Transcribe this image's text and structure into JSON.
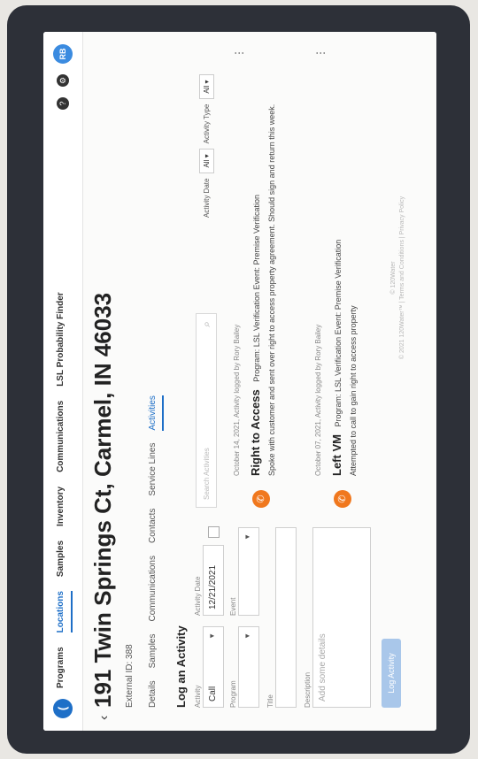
{
  "nav": {
    "logo": "(",
    "items": [
      "Programs",
      "Locations",
      "Samples",
      "Inventory",
      "Communications",
      "LSL Probability Finder"
    ],
    "help_glyph": "?",
    "settings_glyph": "⚙",
    "avatar": "RB"
  },
  "header": {
    "back_glyph": "‹",
    "title": "191 Twin Springs Ct, Carmel, IN 46033",
    "external_id": "External ID: 388"
  },
  "tabs": [
    "Details",
    "Samples",
    "Communications",
    "Contacts",
    "Service Lines",
    "Activities"
  ],
  "log": {
    "title": "Log an Activity",
    "activity_label": "Activity",
    "activity_value": "Call",
    "date_label": "Activity Date",
    "date_value": "12/21/2021",
    "program_label": "Program",
    "event_label": "Event",
    "title_label": "Title",
    "description_label": "Description",
    "description_placeholder": "Add some details",
    "submit": "Log Activity"
  },
  "search": {
    "placeholder": "Search Activities",
    "icon": "⌕"
  },
  "filters": {
    "date_label": "Activity Date",
    "date_value": "All",
    "type_label": "Activity Type",
    "type_value": "All"
  },
  "activities": [
    {
      "icon": "✆",
      "meta": "October 14, 2021, Activity logged by Rory Bailey",
      "title": "Right to Access",
      "tags": "Program: LSL Verification   Event: Premise Verification",
      "desc": "Spoke with customer and sent over right to access property agreement. Should sign and return this week."
    },
    {
      "icon": "✆",
      "meta": "October 07, 2021, Activity logged by Rory Bailey",
      "title": "Left VM",
      "tags": "Program: LSL Verification   Event: Premise Verification",
      "desc": "Attempted to call to gain right to access property"
    }
  ],
  "footer": {
    "line1": "© 120Water",
    "line2": "© 2021 120Water™ | Terms and Conditions | Privacy Policy"
  },
  "colors": {
    "accent": "#1e6fc7",
    "call_icon": "#f0781e",
    "bezel": "#2d3038"
  }
}
